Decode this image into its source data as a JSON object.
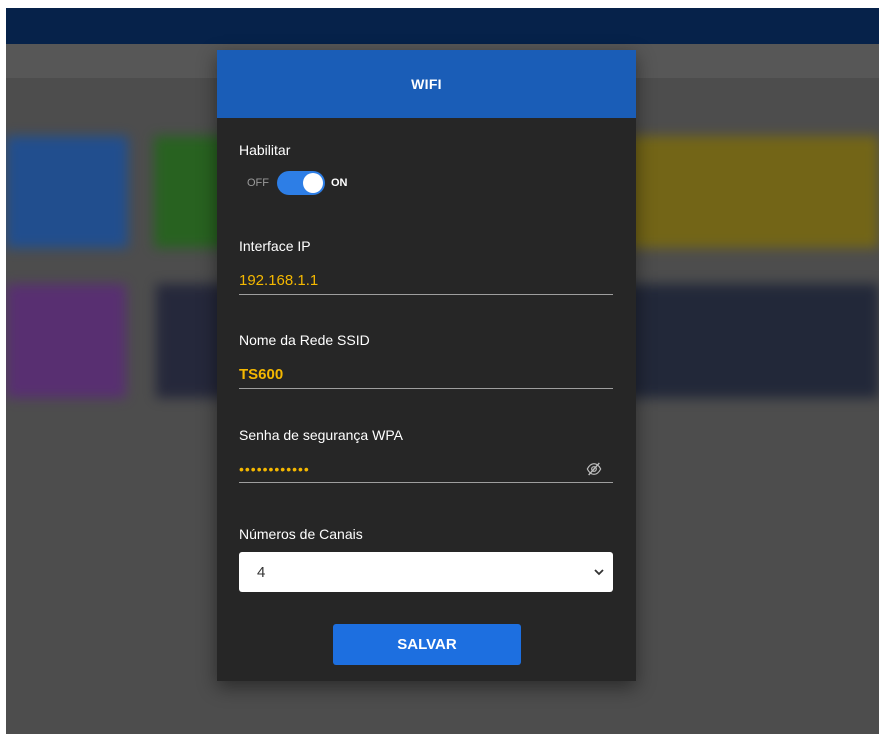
{
  "modal": {
    "title": "WIFI",
    "enable": {
      "label": "Habilitar",
      "off_text": "OFF",
      "on_text": "ON",
      "state": "on"
    },
    "ip": {
      "label": "Interface IP",
      "value": "192.168.1.1"
    },
    "ssid": {
      "label": "Nome da Rede SSID",
      "value": "TS600"
    },
    "wpa": {
      "label": "Senha de segurança WPA",
      "value": "••••••••••••",
      "icon": "eye-slash-icon"
    },
    "channels": {
      "label": "Números de Canais",
      "selected": "4",
      "icon": "chevron-down-icon"
    },
    "save_label": "SALVAR"
  },
  "colors": {
    "accent": "#1a5db7",
    "button": "#1d6fe0",
    "value_text": "#f5b800",
    "modal_bg": "#262626",
    "toggle_on": "#2d7ee6"
  }
}
